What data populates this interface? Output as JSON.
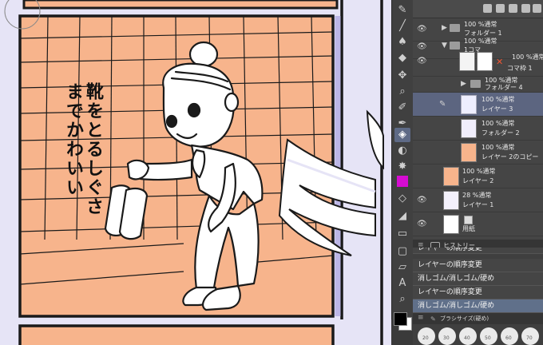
{
  "canvas": {
    "manga_text": [
      "靴をとるしぐさ",
      "までかわいい"
    ],
    "colors": {
      "wall": "#f7b48c",
      "border": "#bcb6e6",
      "ink": "#1a1a1a"
    }
  },
  "toolbar": {
    "icons": [
      "pen-icon",
      "brush-icon",
      "airbrush-icon",
      "blend-icon",
      "eraser-icon",
      "move-icon",
      "zoom-icon",
      "lasso-icon",
      "fill-icon",
      "eyedropper-icon",
      "gradient-icon",
      "figure-icon",
      "text-icon",
      "ruler-icon"
    ],
    "active_tool": "eraser-icon",
    "main_color": "#000000",
    "sub_color": "#ffffff",
    "accent_color": "#d60cd2"
  },
  "layers": {
    "items": [
      {
        "mode": "100 %通常",
        "name": "フォルダー 1",
        "kind": "folder"
      },
      {
        "mode": "100 %通常",
        "name": "1コマ",
        "kind": "folder"
      },
      {
        "mode": "100 %通常",
        "name": "コマ枠 1",
        "kind": "frame"
      },
      {
        "mode": "100 %通常",
        "name": "フォルダー 4",
        "kind": "folder"
      },
      {
        "mode": "100 %通常",
        "name": "レイヤー 3",
        "kind": "raster",
        "selected": true
      },
      {
        "mode": "100 %通常",
        "name": "フォルダー 2",
        "kind": "raster"
      },
      {
        "mode": "100 %通常",
        "name": "レイヤー 2のコピー",
        "kind": "fill"
      },
      {
        "mode": "100 %通常",
        "name": "レイヤー 2",
        "kind": "fill"
      },
      {
        "mode": "28 %通常",
        "name": "レイヤー 1",
        "kind": "raster"
      },
      {
        "mode": "",
        "name": "用紙",
        "kind": "paper"
      }
    ]
  },
  "history": {
    "title": "ヒストリー",
    "items": [
      "レイヤーの順序変更",
      "レイヤーの順序変更",
      "消しゴム/消しゴム/硬め",
      "レイヤーの順序変更",
      "消しゴム/消しゴム/硬め"
    ],
    "selected_index": 4
  },
  "brush_size": {
    "title": "ブラシサイズ(硬め)",
    "sizes": [
      "20",
      "30",
      "40",
      "50",
      "60",
      "70"
    ]
  }
}
